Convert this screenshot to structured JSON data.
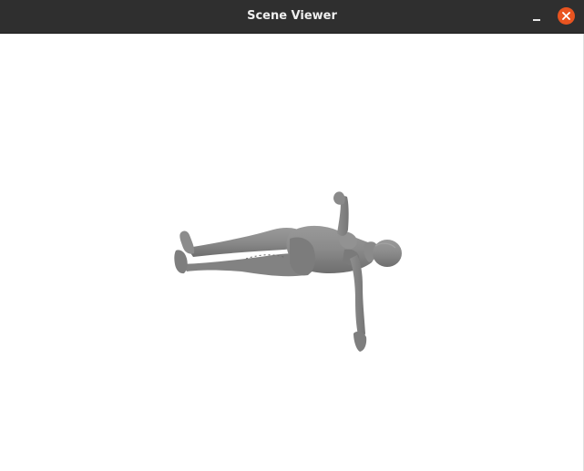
{
  "window": {
    "title": "Scene Viewer"
  },
  "icons": {
    "minimize": "minimize-icon",
    "close": "close-icon"
  },
  "colors": {
    "titlebar": "#2f2f2f",
    "close_button": "#e95420",
    "viewport_background": "#ffffff",
    "model": "#8c8c8c"
  }
}
